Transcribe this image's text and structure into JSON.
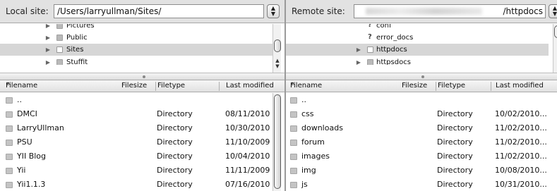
{
  "local": {
    "label": "Local site:",
    "path": "/Users/larryullman/Sites/",
    "tree": [
      {
        "name": "Pictures",
        "icon": "folder-icon",
        "selected": false
      },
      {
        "name": "Public",
        "icon": "folder-icon",
        "selected": false
      },
      {
        "name": "Sites",
        "icon": "folder-icon",
        "selected": true
      },
      {
        "name": "Stuffit",
        "icon": "folder-icon",
        "selected": false
      }
    ],
    "columns": {
      "filename": "Filename",
      "filesize": "Filesize",
      "filetype": "Filetype",
      "modified": "Last modified"
    },
    "files": [
      {
        "name": "..",
        "type": "",
        "modified": ""
      },
      {
        "name": "DMCI",
        "type": "Directory",
        "modified": "08/11/2010"
      },
      {
        "name": "LarryUllman",
        "type": "Directory",
        "modified": "10/30/2010"
      },
      {
        "name": "PSU",
        "type": "Directory",
        "modified": "11/10/2009"
      },
      {
        "name": "YII Blog",
        "type": "Directory",
        "modified": "10/04/2010"
      },
      {
        "name": "Yii",
        "type": "Directory",
        "modified": "11/11/2009"
      },
      {
        "name": "Yii1.1.3",
        "type": "Directory",
        "modified": "07/16/2010"
      }
    ]
  },
  "remote": {
    "label": "Remote site:",
    "path": "/httpdocs",
    "tree": [
      {
        "name": "conf",
        "icon": "key-folder-icon",
        "selected": false
      },
      {
        "name": "error_docs",
        "icon": "key-folder-icon",
        "selected": false
      },
      {
        "name": "httpdocs",
        "icon": "folder-icon",
        "selected": true
      },
      {
        "name": "httpsdocs",
        "icon": "folder-icon",
        "selected": false
      }
    ],
    "columns": {
      "filename": "Filename",
      "filesize": "Filesize",
      "filetype": "Filetype",
      "modified": "Last modified"
    },
    "files": [
      {
        "name": "..",
        "type": "",
        "modified": ""
      },
      {
        "name": "css",
        "type": "Directory",
        "modified": "10/02/2010..."
      },
      {
        "name": "downloads",
        "type": "Directory",
        "modified": "11/02/2010..."
      },
      {
        "name": "forum",
        "type": "Directory",
        "modified": "11/02/2010..."
      },
      {
        "name": "images",
        "type": "Directory",
        "modified": "11/02/2010..."
      },
      {
        "name": "img",
        "type": "Directory",
        "modified": "10/08/2010..."
      },
      {
        "name": "js",
        "type": "Directory",
        "modified": "10/31/2010..."
      }
    ]
  },
  "sort_indicator": "^",
  "stepper_glyph": "▲▼",
  "colors": {
    "selection": "#d6d6d6",
    "header": "#e2e2e2"
  }
}
